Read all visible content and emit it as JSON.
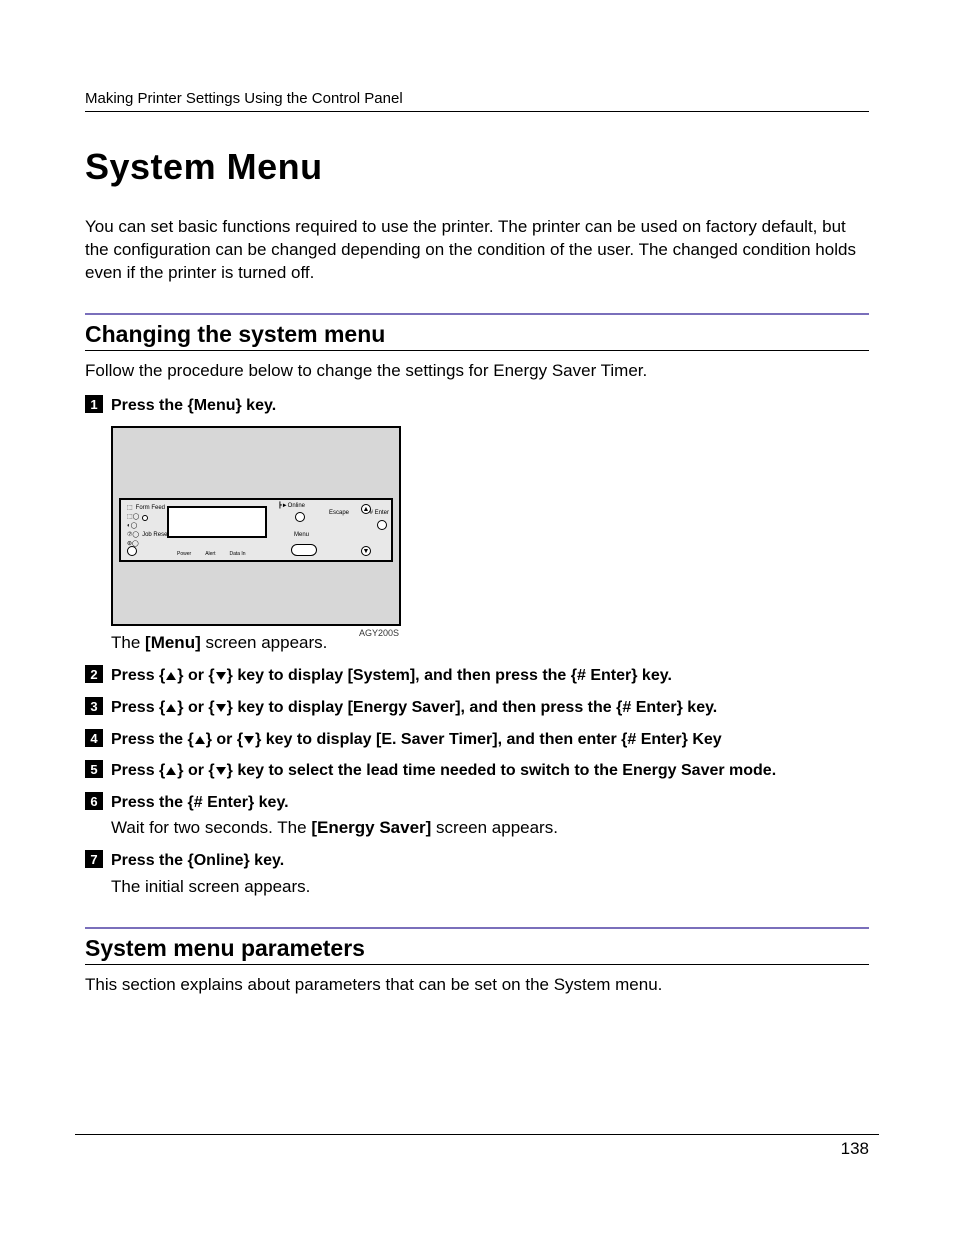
{
  "header": "Making Printer Settings Using the Control Panel",
  "title": "System Menu",
  "intro": "You can set basic functions required to use the printer. The printer can be used on factory default, but the configuration can be changed depending on the condition of the user. The changed condition holds even if the printer is turned off.",
  "section1": {
    "heading": "Changing the system menu",
    "lead": "Follow the procedure below to change the settings for Energy Saver Timer.",
    "steps": [
      {
        "n": "1",
        "pre": "Press the ",
        "keyOpen": "{",
        "keyLabel": "Menu",
        "keyClose": "}",
        "post": " key.",
        "body_pre": "The ",
        "body_bold": "[Menu]",
        "body_post": " screen appears."
      },
      {
        "n": "2",
        "t1": "Press ",
        "kOpen": "{",
        "kClose": "}",
        "t2": " or ",
        "t3": " key to display ",
        "screen": "[System]",
        "t4": ", and then press the ",
        "enter": "# Enter",
        "t5": " key."
      },
      {
        "n": "3",
        "t1": "Press ",
        "kOpen": "{",
        "kClose": "}",
        "t2": " or ",
        "t3": " key to display ",
        "screen": "[Energy Saver]",
        "t4": ", and then press the ",
        "enter": "# Enter",
        "t5": " key."
      },
      {
        "n": "4",
        "t1": "Press the ",
        "kOpen": "{",
        "kClose": "}",
        "t2": " or ",
        "t3": " key to display ",
        "screen": "[E. Saver Timer]",
        "t4": ", and then enter ",
        "enter": "# Enter",
        "t5": " Key"
      },
      {
        "n": "5",
        "t1": "Press ",
        "kOpen": "{",
        "kClose": "}",
        "t2": " or ",
        "t3": " key to select the lead time needed to switch to the Energy Saver mode.",
        "screen": "",
        "t4": "",
        "enter": "",
        "t5": ""
      },
      {
        "n": "6",
        "pre": "Press the ",
        "keyOpen": "{",
        "keyLabel": "# Enter",
        "keyClose": "}",
        "post": " key.",
        "body_pre": "Wait for two seconds. The ",
        "body_bold": "[Energy Saver]",
        "body_post": " screen appears."
      },
      {
        "n": "7",
        "pre": "Press the ",
        "keyOpen": "{",
        "keyLabel": "Online",
        "keyClose": "}",
        "post": " key.",
        "body_pre": "The initial screen appears.",
        "body_bold": "",
        "body_post": ""
      }
    ]
  },
  "panel": {
    "code": "AGY200S",
    "labels": {
      "formfeed": "Form Feed",
      "jobreset": "Job Reset",
      "online": "Online",
      "escape": "Escape",
      "enter": "# Enter",
      "menu": "Menu",
      "power": "Power",
      "alert": "Alert",
      "datain": "Data In"
    }
  },
  "section2": {
    "heading": "System menu parameters",
    "lead": "This section explains about parameters that can be set on the System menu."
  },
  "pageNumber": "138"
}
